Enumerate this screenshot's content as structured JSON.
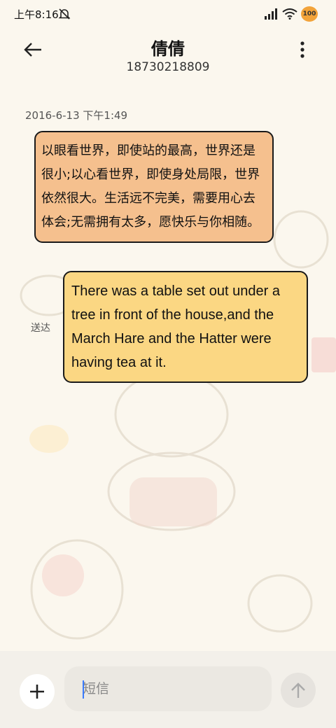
{
  "status_bar": {
    "time": "上午8:16",
    "battery": "100",
    "icons": [
      "mute-icon",
      "signal-icon",
      "wifi-icon",
      "battery-icon"
    ]
  },
  "header": {
    "contact_name": "倩倩",
    "phone_number": "18730218809",
    "back_icon": "arrow-left-icon",
    "menu_icon": "more-vertical-icon"
  },
  "conversation": {
    "timestamp": "2016-6-13 下午1:49",
    "messages": [
      {
        "text": "以眼看世界，即使站的最高，世界还是很小;以心看世界，即使身处局限，世界依然很大。生活远不完美，需要用心去体会;无需拥有太多，愿快乐与你相随。",
        "color": "#f5c08e"
      },
      {
        "text": "There was a table set out under a tree in front of the house,and the March Hare and the Hatter were having tea at it.",
        "color": "#fbd783"
      }
    ],
    "delivery_status": "送达"
  },
  "composer": {
    "placeholder": "短信",
    "add_icon": "plus-icon",
    "send_icon": "arrow-up-icon"
  }
}
